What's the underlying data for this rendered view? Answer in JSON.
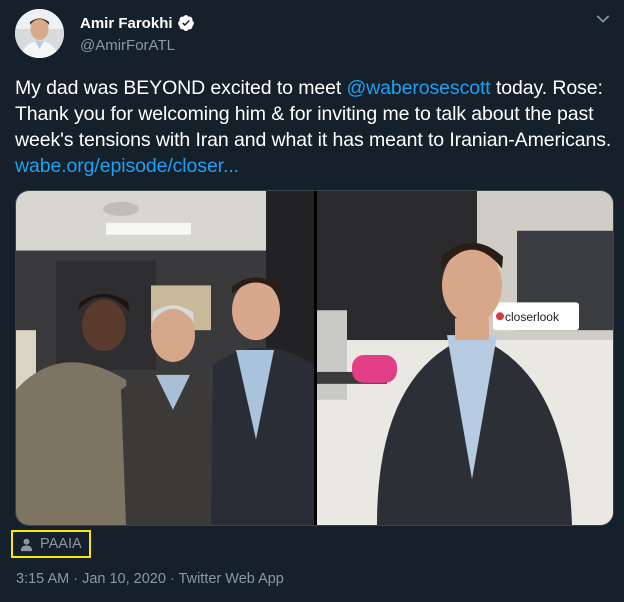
{
  "author": {
    "display_name": "Amir Farokhi",
    "handle": "@AmirForATL"
  },
  "tweet": {
    "text_before": "My dad was BEYOND excited to meet ",
    "mention": "@waberosescott",
    "text_after": " today. Rose: Thank you for welcoming him & for inviting me to talk about the past week's tensions with Iran and what it has meant to Iranian-Americans. ",
    "link": "wabe.org/episode/closer..."
  },
  "media": {
    "studio_sign": "closerlook"
  },
  "location": {
    "label": "PAAIA"
  },
  "meta": {
    "timestamp": "3:15 AM · Jan 10, 2020 · Twitter Web App"
  },
  "icons": {
    "verified": "verified-badge-icon",
    "caret": "chevron-down-icon",
    "location": "person-icon"
  },
  "colors": {
    "background": "#15202b",
    "link": "#1da1f2",
    "secondary_text": "#8899a6",
    "highlight_box": "#ffe600"
  }
}
